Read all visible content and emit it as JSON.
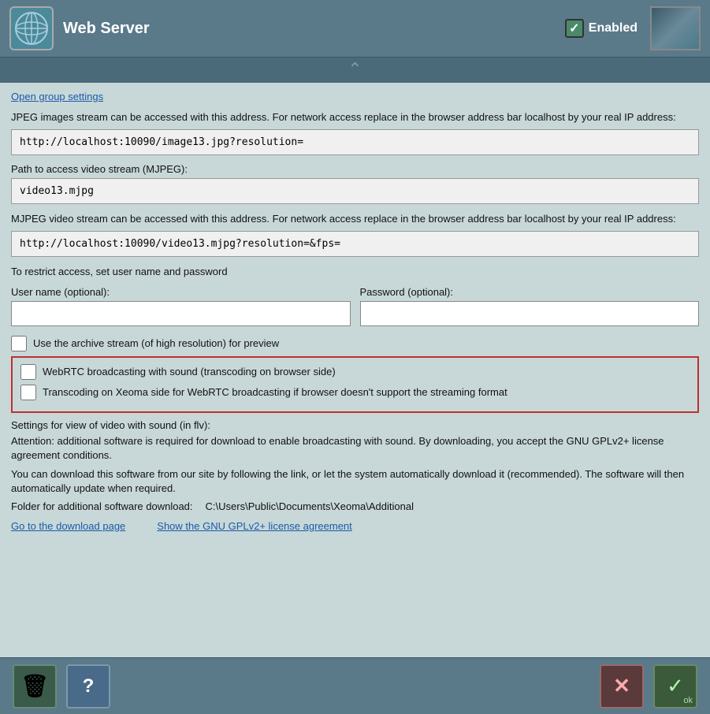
{
  "header": {
    "title": "Web Server",
    "enabled_label": "Enabled",
    "open_group_settings": "Open group settings"
  },
  "jpeg_stream": {
    "info": "JPEG images stream can be accessed with this address. For network access replace in the browser address bar localhost by your real IP address:",
    "url": "http://localhost:10090/image13.jpg?resolution="
  },
  "mjpeg_path": {
    "label": "Path to access video stream (MJPEG):",
    "path": "video13.mjpg"
  },
  "mjpeg_stream": {
    "info": "MJPEG video stream can be accessed with this address. For network access replace in the browser address bar localhost by your real IP address:",
    "url": "http://localhost:10090/video13.mjpg?resolution=&fps="
  },
  "access": {
    "restrict_label": "To restrict access, set user name and password",
    "username_label": "User name (optional):",
    "username_value": "",
    "password_label": "Password (optional):",
    "password_value": ""
  },
  "checkboxes": {
    "archive_label": "Use the archive stream (of high resolution) for preview",
    "webrtc_label": "WebRTC broadcasting with sound (transcoding on browser side)",
    "transcoding_label": "Transcoding on Xeoma side for WebRTC broadcasting if browser doesn't support the streaming format"
  },
  "flv_settings": {
    "label": "Settings for view of video with sound (in flv):",
    "attention": "Attention: additional software is required for download to enable broadcasting with sound. By downloading, you accept the GNU GPLv2+ license agreement conditions.",
    "download_info": "You can download this software from our site by following the link, or let the system automatically download it (recommended). The software will then automatically update when required.",
    "folder_label": "Folder for additional software download:",
    "folder_path": "C:\\Users\\Public\\Documents\\Xeoma\\Additional"
  },
  "links": {
    "download_page": "Go to the download page",
    "license": "Show the GNU GPLv2+ license agreement"
  },
  "toolbar": {
    "trash_icon": "🗑",
    "help_icon": "?",
    "cancel_icon": "✕",
    "ok_icon": "✓",
    "ok_label": "ok"
  }
}
